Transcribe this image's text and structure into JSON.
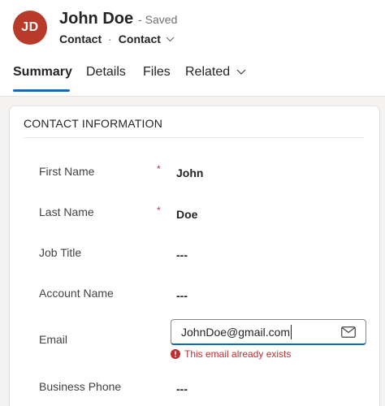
{
  "record": {
    "initials": "JD",
    "name": "John Doe",
    "status": "- Saved",
    "entity": "Contact",
    "separator": "·",
    "form_selector": "Contact"
  },
  "tabs": [
    {
      "label": "Summary",
      "active": true
    },
    {
      "label": "Details",
      "active": false
    },
    {
      "label": "Files",
      "active": false
    },
    {
      "label": "Related",
      "active": false
    }
  ],
  "section": {
    "title": "CONTACT INFORMATION"
  },
  "fields": {
    "first_name": {
      "label": "First Name",
      "required": "*",
      "value": "John"
    },
    "last_name": {
      "label": "Last Name",
      "required": "*",
      "value": "Doe"
    },
    "job_title": {
      "label": "Job Title",
      "value": "---"
    },
    "account_name": {
      "label": "Account Name",
      "value": "---"
    },
    "email": {
      "label": "Email",
      "value": "JohnDoe@gmail.com",
      "error": "This email already exists"
    },
    "business_phone": {
      "label": "Business Phone",
      "value": "---"
    }
  },
  "colors": {
    "avatar": "#b83a2b",
    "accent": "#0f6cbd",
    "error": "#bc2f32",
    "required": "#c4314b"
  },
  "icons": [
    "chevron-down-icon",
    "mail-icon",
    "error-icon"
  ]
}
